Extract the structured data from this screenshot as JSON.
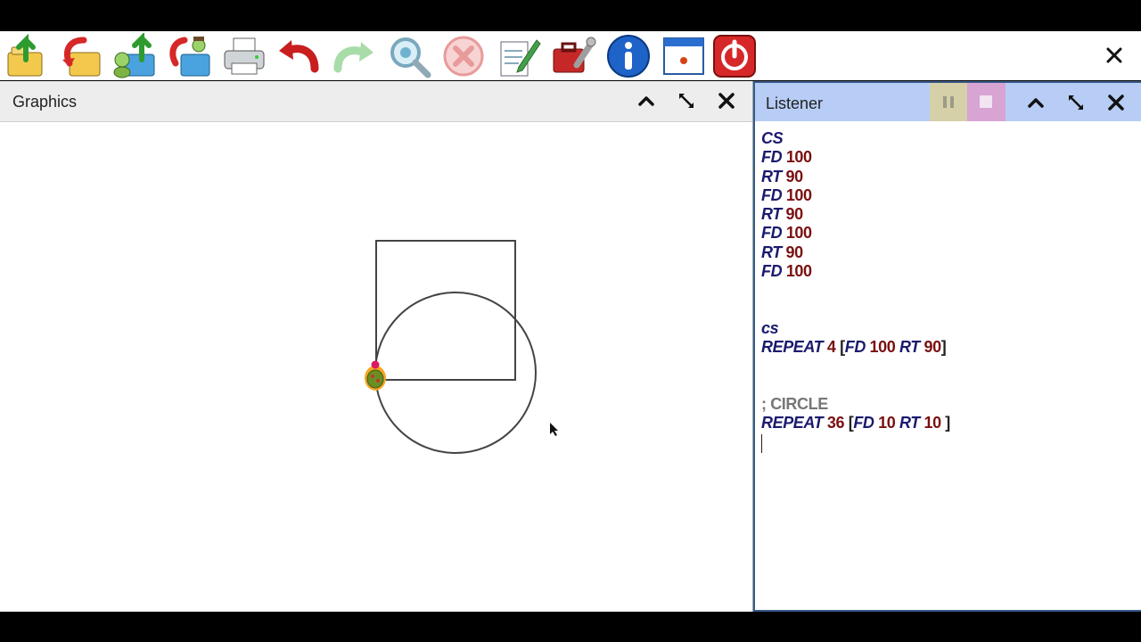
{
  "toolbar": {
    "icons": [
      "load-icon",
      "save-icon",
      "load-turtle-icon",
      "save-turtle-icon",
      "print-icon",
      "undo-icon",
      "redo-icon",
      "zoom-icon",
      "cancel-icon",
      "edit-icon",
      "tools-icon",
      "info-icon",
      "window-icon",
      "power-icon"
    ]
  },
  "graphics": {
    "title": "Graphics"
  },
  "listener": {
    "title": "Listener",
    "lines": [
      [
        {
          "t": "CS",
          "c": "kw"
        }
      ],
      [
        {
          "t": "FD",
          "c": "kw"
        },
        {
          "t": " "
        },
        {
          "t": "100",
          "c": "num"
        }
      ],
      [
        {
          "t": "RT",
          "c": "kw"
        },
        {
          "t": " "
        },
        {
          "t": "90",
          "c": "num"
        }
      ],
      [
        {
          "t": "FD",
          "c": "kw"
        },
        {
          "t": " "
        },
        {
          "t": "100",
          "c": "num"
        }
      ],
      [
        {
          "t": "RT",
          "c": "kw"
        },
        {
          "t": " "
        },
        {
          "t": "90",
          "c": "num"
        }
      ],
      [
        {
          "t": "FD",
          "c": "kw"
        },
        {
          "t": " "
        },
        {
          "t": "100",
          "c": "num"
        }
      ],
      [
        {
          "t": "RT",
          "c": "kw"
        },
        {
          "t": " "
        },
        {
          "t": "90",
          "c": "num"
        }
      ],
      [
        {
          "t": "FD",
          "c": "kw"
        },
        {
          "t": " "
        },
        {
          "t": "100",
          "c": "num"
        }
      ],
      [],
      [],
      [
        {
          "t": "cs",
          "c": "kw"
        }
      ],
      [
        {
          "t": "REPEAT",
          "c": "kw"
        },
        {
          "t": " "
        },
        {
          "t": "4",
          "c": "num"
        },
        {
          "t": " [",
          "c": "br"
        },
        {
          "t": "FD",
          "c": "kw"
        },
        {
          "t": " "
        },
        {
          "t": "100",
          "c": "num"
        },
        {
          "t": " "
        },
        {
          "t": "RT",
          "c": "kw"
        },
        {
          "t": " "
        },
        {
          "t": "90",
          "c": "num"
        },
        {
          "t": "]",
          "c": "br"
        }
      ],
      [],
      [],
      [
        {
          "t": "; CIRCLE",
          "c": "cmt"
        }
      ],
      [
        {
          "t": "REPEAT",
          "c": "kw"
        },
        {
          "t": " "
        },
        {
          "t": "36",
          "c": "num"
        },
        {
          "t": " [",
          "c": "br"
        },
        {
          "t": "FD",
          "c": "kw"
        },
        {
          "t": " "
        },
        {
          "t": "10",
          "c": "num"
        },
        {
          "t": " "
        },
        {
          "t": "RT",
          "c": "kw"
        },
        {
          "t": " "
        },
        {
          "t": "10",
          "c": "num"
        },
        {
          "t": " ]",
          "c": "br"
        }
      ]
    ]
  },
  "colors": {
    "keyword": "#1a1a6e",
    "number": "#7a1010",
    "comment": "#777777",
    "listener_header": "#b7cdf5"
  }
}
